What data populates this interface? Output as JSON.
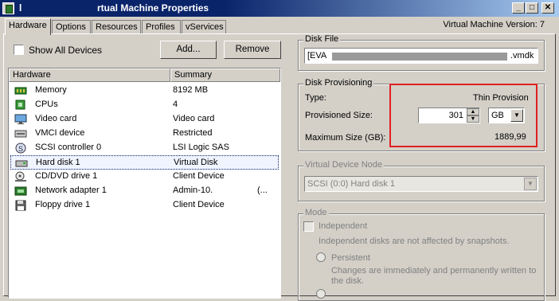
{
  "window": {
    "title_fragment": "l",
    "title": "rtual Machine Properties",
    "buttons": {
      "minimize": "_",
      "maximize": "□",
      "close": "✕"
    }
  },
  "tabs": [
    "Hardware",
    "Options",
    "Resources",
    "Profiles",
    "vServices"
  ],
  "version_label": "Virtual Machine Version: 7",
  "show_all_devices": "Show All Devices",
  "add_button": "Add...",
  "remove_button": "Remove",
  "table": {
    "headers": [
      "Hardware",
      "Summary"
    ],
    "rows": [
      {
        "name": "Memory",
        "summary": "8192 MB",
        "extra": "",
        "icon": "memory-icon"
      },
      {
        "name": "CPUs",
        "summary": "4",
        "extra": "",
        "icon": "cpu-icon"
      },
      {
        "name": "Video card",
        "summary": "Video card",
        "extra": "",
        "icon": "monitor-icon"
      },
      {
        "name": "VMCI device",
        "summary": "Restricted",
        "extra": "",
        "icon": "device-icon"
      },
      {
        "name": "SCSI controller 0",
        "summary": "LSI Logic SAS",
        "extra": "",
        "icon": "scsi-icon"
      },
      {
        "name": "Hard disk 1",
        "summary": "Virtual Disk",
        "extra": "",
        "icon": "disk-icon"
      },
      {
        "name": "CD/DVD drive 1",
        "summary": "Client Device",
        "extra": "",
        "icon": "cd-icon"
      },
      {
        "name": "Network adapter 1",
        "summary": "Admin-10.",
        "extra": "(...",
        "icon": "network-icon"
      },
      {
        "name": "Floppy drive 1",
        "summary": "Client Device",
        "extra": "",
        "icon": "floppy-icon"
      }
    ]
  },
  "disk_file": {
    "legend": "Disk File",
    "value_start": "[EVA",
    "value_end": ".vmdk"
  },
  "provisioning": {
    "legend": "Disk Provisioning",
    "type_label": "Type:",
    "type_value": "Thin Provision",
    "size_label": "Provisioned Size:",
    "size_value": "301",
    "unit": "GB",
    "max_label": "Maximum Size (GB):",
    "max_value": "1889,99"
  },
  "vdn": {
    "legend": "Virtual Device Node",
    "value": "SCSI (0:0) Hard disk 1"
  },
  "mode": {
    "legend": "Mode",
    "independent": "Independent",
    "independent_desc": "Independent disks are not affected by snapshots.",
    "persistent": "Persistent",
    "persistent_desc": "Changes are immediately and permanently written to the disk."
  },
  "colors": {
    "highlight_box": "#e02020",
    "title_bar": "#0a246a"
  }
}
